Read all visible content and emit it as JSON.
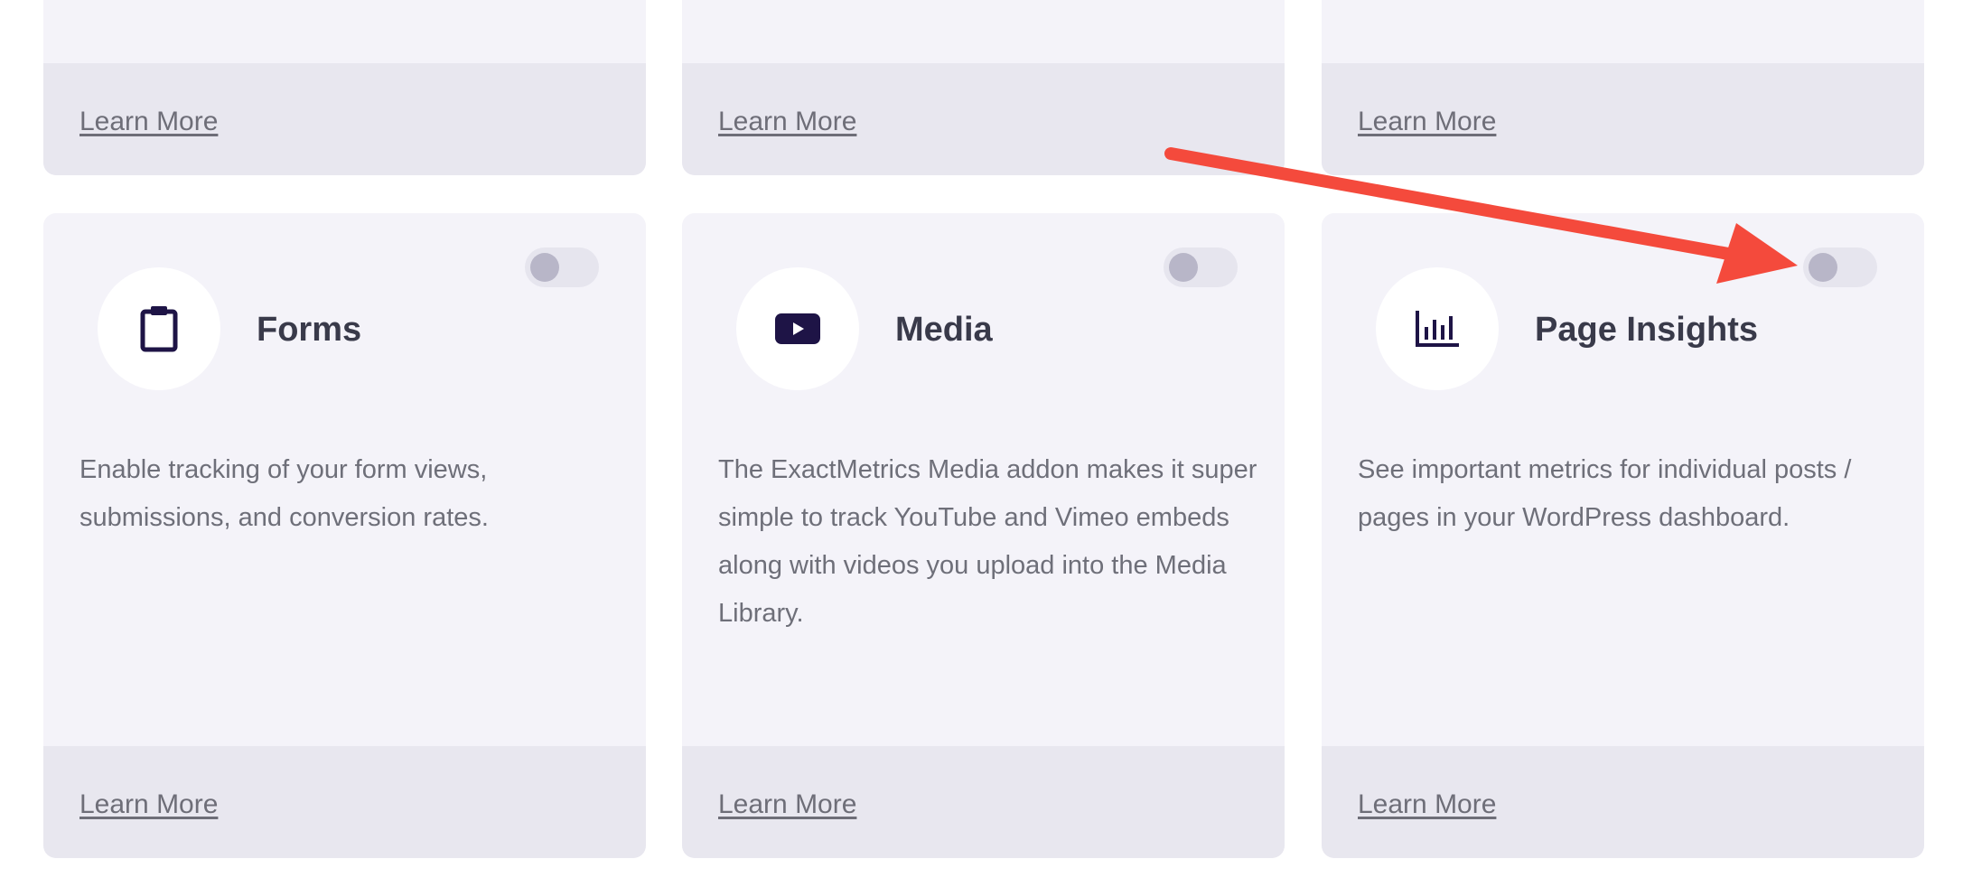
{
  "top_row": [
    {
      "learn_more": "Learn More"
    },
    {
      "learn_more": "Learn More"
    },
    {
      "learn_more": "Learn More"
    }
  ],
  "addons": [
    {
      "title": "Forms",
      "icon": "clipboard-icon",
      "description": "Enable tracking of your form views, submissions, and conversion rates.",
      "learn_more": "Learn More",
      "enabled": false
    },
    {
      "title": "Media",
      "icon": "youtube-play-icon",
      "description": "The ExactMetrics Media addon makes it super simple to track YouTube and Vimeo embeds along with videos you upload into the Media Library.",
      "learn_more": "Learn More",
      "enabled": false
    },
    {
      "title": "Page Insights",
      "icon": "bar-chart-icon",
      "description": "See important metrics for individual posts / pages in your WordPress dashboard.",
      "learn_more": "Learn More",
      "enabled": false
    }
  ],
  "colors": {
    "card_bg": "#f4f3f9",
    "footer_bg": "#e8e7ef",
    "icon_color": "#1e1446",
    "title_color": "#393a4a",
    "text_color": "#6e6f79",
    "toggle_track": "#e6e5ee",
    "toggle_knob": "#b8b6c8",
    "annotation_arrow": "#f44a3c"
  }
}
